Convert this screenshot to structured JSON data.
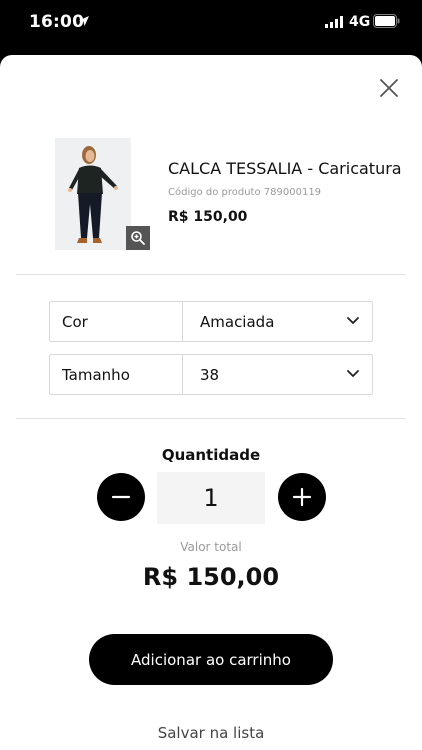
{
  "status_bar": {
    "time": "16:00",
    "network": "4G"
  },
  "product": {
    "name": "CALCA TESSALIA - Caricatura",
    "code": "Código do produto 789000119",
    "price": "R$ 150,00"
  },
  "options": [
    {
      "label": "Cor",
      "value": "Amaciada"
    },
    {
      "label": "Tamanho",
      "value": "38"
    }
  ],
  "quantity": {
    "title": "Quantidade",
    "value": "1"
  },
  "total": {
    "label": "Valor total",
    "value": "R$ 150,00"
  },
  "actions": {
    "add_to_cart": "Adicionar ao carrinho",
    "save_list": "Salvar na lista"
  },
  "icons": {
    "location": "location-arrow-icon",
    "signal": "signal-icon",
    "battery": "battery-icon",
    "close": "close-icon",
    "zoom": "zoom-in-icon",
    "chevron": "chevron-down-icon",
    "minus": "minus-icon",
    "plus": "plus-icon"
  },
  "colors": {
    "primary": "#000000",
    "muted_text": "#9a9a9a",
    "field_border": "#d9d9d9"
  }
}
